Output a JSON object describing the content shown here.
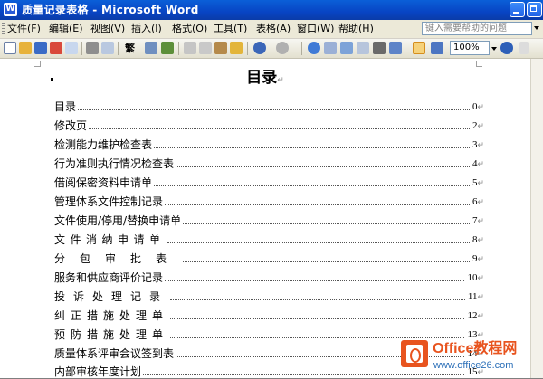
{
  "window": {
    "title": "质量记录表格 - Microsoft Word",
    "app_icon_letter": "W"
  },
  "menu": {
    "items": [
      "文件(F)",
      "编辑(E)",
      "视图(V)",
      "插入(I)",
      "格式(O)",
      "工具(T)",
      "表格(A)",
      "窗口(W)",
      "帮助(H)"
    ],
    "help_placeholder": "键入需要帮助的问题"
  },
  "toolbar": {
    "zoom": "100%"
  },
  "document": {
    "title": "目录",
    "paragraph_mark": "↵",
    "toc": [
      {
        "label": "目录",
        "page": "0"
      },
      {
        "label": "修改页",
        "page": "2"
      },
      {
        "label": "检测能力维护检查表",
        "page": "3"
      },
      {
        "label": "行为准则执行情况检查表",
        "page": "4"
      },
      {
        "label": "借阅保密资料申请单",
        "page": "5"
      },
      {
        "label": "管理体系文件控制记录",
        "page": "6"
      },
      {
        "label": "文件使用/停用/替换申请单",
        "page": "7"
      },
      {
        "label": "文件消纳申请单",
        "page": "8"
      },
      {
        "label": "分包审批表",
        "page": "9"
      },
      {
        "label": "服务和供应商评价记录",
        "page": "10"
      },
      {
        "label": "投诉处理记录",
        "page": "11"
      },
      {
        "label": "纠正措施处理单",
        "page": "12"
      },
      {
        "label": "预防措施处理单",
        "page": "13"
      },
      {
        "label": "质量体系评审会议签到表",
        "page": "14"
      },
      {
        "label": "内部审核年度计划",
        "page": "15"
      }
    ]
  },
  "watermark": {
    "brand": "Office教程网",
    "url": "www.office26.com"
  }
}
